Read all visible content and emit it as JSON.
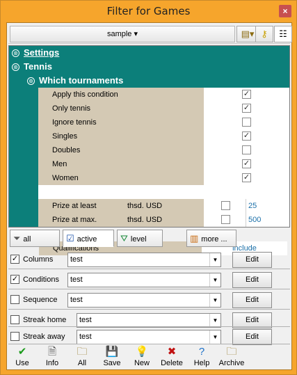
{
  "window": {
    "title": "Filter for Games",
    "close_glyph": "×"
  },
  "toolbar": {
    "preset": "sample",
    "preset_arrow": "▾",
    "buttons": [
      {
        "icon": "folder-menu-icon",
        "glyph": "▤▾"
      },
      {
        "icon": "key-icon",
        "glyph": "⚷"
      },
      {
        "icon": "tree-view-icon",
        "glyph": "☷"
      }
    ]
  },
  "tree": {
    "settings": "Settings",
    "tennis": "Tennis",
    "which": "Which tournaments",
    "expander": "⊛",
    "rows": [
      {
        "label": "Apply this condition",
        "checked": true
      },
      {
        "label": "Only tennis",
        "checked": true
      },
      {
        "label": "Ignore tennis",
        "checked": false
      },
      {
        "label": "Singles",
        "checked": true
      },
      {
        "label": "Doubles",
        "checked": false
      },
      {
        "label": "Men",
        "checked": true
      },
      {
        "label": "Women",
        "checked": true
      }
    ],
    "prize_least": {
      "label": "Prize at least",
      "unit": "thsd. USD",
      "checked": false,
      "value": "25"
    },
    "prize_max": {
      "label": "Prize at max.",
      "unit": "thsd. USD",
      "checked": false,
      "value": "500"
    },
    "qualifications": {
      "label": "Qualifications",
      "value": "include"
    },
    "check_glyph": "✓"
  },
  "tabs": [
    {
      "label": "all",
      "icon": "funnel-icon",
      "glyph": "⏷"
    },
    {
      "label": "active",
      "icon": "checkbox-icon",
      "glyph": "☑"
    },
    {
      "label": "level",
      "icon": "funnel-check-icon",
      "glyph": "⛛"
    },
    {
      "label": "more ...",
      "icon": "columns-icon",
      "glyph": "▥"
    }
  ],
  "filters": [
    {
      "label": "Columns",
      "checked": true,
      "value": "test",
      "button": "Edit"
    },
    {
      "label": "Conditions",
      "checked": true,
      "value": "test",
      "button": "Edit"
    },
    {
      "label": "Sequence",
      "checked": false,
      "value": "test",
      "button": "Edit"
    },
    {
      "label": "Streak home",
      "checked": false,
      "value": "test",
      "button": "Edit"
    },
    {
      "label": "Streak away",
      "checked": false,
      "value": "test",
      "button": "Edit"
    }
  ],
  "select_arrow": "▼",
  "bottom": [
    {
      "label": "Use",
      "icon": "checkmark-icon",
      "glyph": "✔",
      "color": "#1a9a1a"
    },
    {
      "label": "Info",
      "icon": "info-document-icon",
      "glyph": "🗎",
      "color": "#555555"
    },
    {
      "label": "All",
      "icon": "folders-icon",
      "glyph": "🗀",
      "color": "#8a6a10"
    },
    {
      "label": "Save",
      "icon": "floppy-disk-icon",
      "glyph": "💾",
      "color": "#222222"
    },
    {
      "label": "New",
      "icon": "lightbulb-icon",
      "glyph": "💡",
      "color": "#c8b400"
    },
    {
      "label": "Delete",
      "icon": "delete-x-icon",
      "glyph": "✖",
      "color": "#c01010"
    },
    {
      "label": "Help",
      "icon": "help-question-icon",
      "glyph": "?",
      "color": "#1a6fc8"
    },
    {
      "label": "Archive",
      "icon": "archive-icon",
      "glyph": "🗀",
      "color": "#8a6a10"
    }
  ]
}
